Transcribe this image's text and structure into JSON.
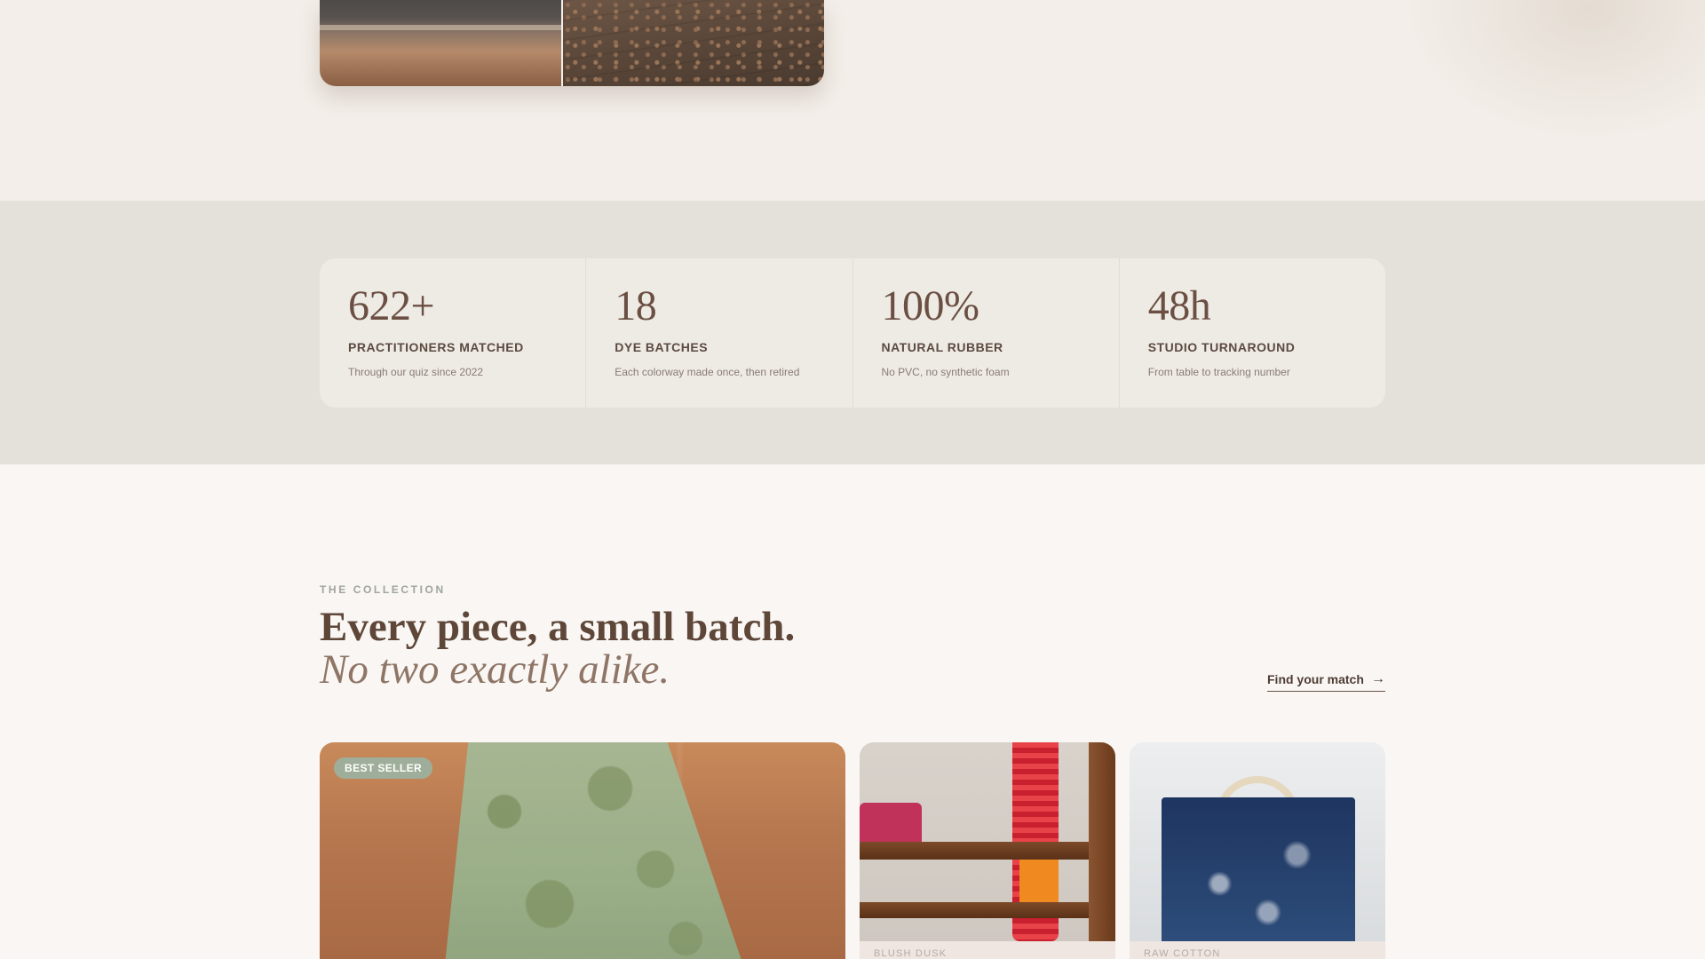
{
  "stats": [
    {
      "value": "622+",
      "label": "PRACTITIONERS MATCHED",
      "desc": "Through our quiz since 2022"
    },
    {
      "value": "18",
      "label": "DYE BATCHES",
      "desc": "Each colorway made once, then retired"
    },
    {
      "value": "100%",
      "label": "NATURAL RUBBER",
      "desc": "No PVC, no synthetic foam"
    },
    {
      "value": "48h",
      "label": "STUDIO TURNAROUND",
      "desc": "From table to tracking number"
    }
  ],
  "collection": {
    "eyebrow": "THE COLLECTION",
    "headline": "Every piece, a small batch.",
    "headline_italic": "No two exactly alike.",
    "cta": "Find your match",
    "cta_icon": "arrow-right-icon"
  },
  "products": [
    {
      "badge": "BEST SELLER"
    },
    {
      "label": "BLUSH DUSK"
    },
    {
      "label": "RAW COTTON"
    }
  ],
  "colors": {
    "background": "#f9f6f3",
    "stats_band": "#e3e1da",
    "accent_text": "#6b4f42",
    "eyebrow": "#9fa69b",
    "badge": "#9fae9a"
  }
}
